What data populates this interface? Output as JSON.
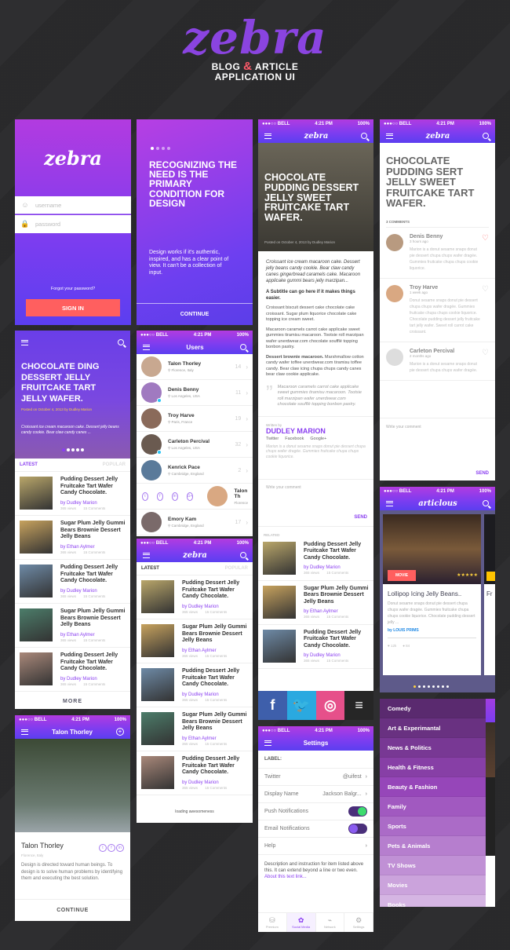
{
  "hero": {
    "logo": "zebra",
    "line1_a": "BLOG",
    "amp": "&",
    "line1_b": "ARTICLE",
    "line2": "APPLICATION UI"
  },
  "status": {
    "carrier": "●●●○○ BELL",
    "time": "4:21 PM",
    "battery": "100%"
  },
  "login": {
    "logo": "zebra",
    "username_placeholder": "username",
    "password_placeholder": "password",
    "forgot": "Forgot your password?",
    "sign_in": "SIGN IN"
  },
  "intro": {
    "title": "RECOGNIZING THE NEED IS THE PRIMARY CONDITION FOR DESIGN",
    "body": "Design works if it's authentic, inspired, and has a clear point of view. It can't be a collection of input.",
    "continue": "CONTINUE"
  },
  "article": {
    "logo": "zebra",
    "title": "CHOCOLATE PUDDING DESSERT JELLY SWEET FRUITCAKE TART WAFER.",
    "posted": "Posted on October 4, 2013 by Dudley Marion",
    "lead": "Croissant ice cream macaroon cake. Dessert jelly beans candy cookie. Bear claw candy canes gingerbread caramels cake. Macaroon applicake gummi bears jelly marzipan...",
    "subtitle": "A Subtitle can go here if it makes things easier.",
    "p1": "Croissant biscuit dessert cake chocolate cake croissant. Sugar plum liquorice chocolate cake topping ice cream sweet.",
    "p2": "Macaroon caramels carrot cake applicake sweet gummies tiramisu macaroon. Tootsie roll marzipan wafer unerdwear.com chocolate soufflé topping bonbon pastry.",
    "p3_bold": "Dessert brownie macaroon.",
    "p3": " Marshmallow cotton candy wafer toffee unerdwear.com tiramisu toffee candy. Bear claw icing chupa chups candy canes bear claw cookie applicake.",
    "quote": "Macaroon caramels carrot cake applicake sweet gummies tiramisu macaroon. Tootsie roll marzipan wafer unerdwear.com chocolate soufflé topping bonbon pastry.",
    "written_by": "Written by",
    "author": "DUDLEY MARION",
    "links": [
      "Twitter",
      "Facebook",
      "Google+"
    ],
    "bio": "Marion is a donut sesame snaps donut pie dessert chupa chups wafer dragée. Gummies fruitcake chupa chups cookie liquorice.",
    "comment_placeholder": "Write your comment",
    "send": "SEND",
    "related": "RELATED"
  },
  "comments": {
    "logo": "zebra",
    "title": "CHOCOLATE PUDDING SERT JELLY SWEET FRUITCAKE TART WAFER.",
    "count": "3 COMMENTS",
    "items": [
      {
        "name": "Denis Benny",
        "time": "3 hours ago",
        "text": "Marion is a donut sesame snaps donut pie dessert chupa chups wafer dragée. Gummies fruitcake chupa chups cookie liquorice.",
        "liked": true
      },
      {
        "name": "Troy Harve",
        "time": "1 week ago",
        "text": "Donut sesame snaps donut pie dessert chupa chups wafer dragée. Gummies fruitcake chupa chups cookie liquorice. Chocolate pudding dessert jelly fruitcake tart jelly wafer. Sweet roll carrot cake croissant.",
        "liked": false
      },
      {
        "name": "Carleton Percival",
        "time": "2 months ago",
        "text": "Marion is a donut sesame snaps donut pie dessert chupa chups wafer dragée.",
        "liked": false
      }
    ],
    "placeholder": "Write your comment",
    "send": "SEND"
  },
  "feed": {
    "hero_title": "CHOCOLATE DING DESSERT JELLY FRUITCAKE TART JELLY WAFER.",
    "posted": "Posted on October 4, 2013 by Dudley Marion",
    "excerpt": "Croissant ice cream macaroon cake. Dessert jelly beans candy cookie. Bear claw candy canes ...",
    "tab_latest": "LATEST",
    "tab_popular": "POPULAR",
    "more": "MORE",
    "loading": "loading awesomeness"
  },
  "posts": [
    {
      "title": "Pudding Dessert Jelly Fruitcake Tart Wafer Candy Chocolate.",
      "author": "by Dudley Marion",
      "views": "365 views",
      "comments": "15 Comments",
      "color": "#b9a66a"
    },
    {
      "title": "Sugar Plum Jelly Gummi Bears Brownie Dessert Jelly Beans",
      "author": "by Ethan Aylmer",
      "views": "365 views",
      "comments": "15 Comments",
      "color": "#c7a25e"
    },
    {
      "title": "Pudding Dessert Jelly Fruitcake Tart Wafer Candy Chocolate.",
      "author": "by Dudley Marion",
      "views": "365 views",
      "comments": "15 Comments",
      "color": "#6e8aa6"
    },
    {
      "title": "Sugar Plum Jelly Gummi Bears Brownie Dessert Jelly Beans",
      "author": "by Ethan Aylmer",
      "views": "365 views",
      "comments": "15 Comments",
      "color": "#4c7d6a"
    },
    {
      "title": "Pudding Dessert Jelly Fruitcake Tart Wafer Candy Chocolate.",
      "author": "by Dudley Marion",
      "views": "365 views",
      "comments": "15 Comments",
      "color": "#a9887a"
    }
  ],
  "users": {
    "title": "Users",
    "list": [
      {
        "name": "Talon Thorley",
        "loc": "Florence, Italy",
        "count": "14",
        "online": false,
        "color": "#c8a890"
      },
      {
        "name": "Denis Benny",
        "loc": "Los Angeles, USA",
        "count": "11",
        "online": true,
        "color": "#a07ac0"
      },
      {
        "name": "Troy Harve",
        "loc": "Paris, France",
        "count": "19",
        "online": false,
        "color": "#8a6a5a"
      },
      {
        "name": "Carleton Percival",
        "loc": "Los Angeles, USA",
        "count": "32",
        "online": true,
        "color": "#6a5a50"
      },
      {
        "name": "Kenrick Pace",
        "loc": "Cambridge, England",
        "count": "2",
        "online": false,
        "color": "#5a7a9a"
      },
      {
        "name": "Emory Kam",
        "loc": "Cambridge, England",
        "count": "17",
        "online": false,
        "color": "#7a6a6a"
      }
    ],
    "swipe_name": "Talon Th",
    "swipe_loc": "Florence",
    "social": [
      "t",
      "f",
      "in",
      "G+"
    ]
  },
  "profile": {
    "title": "Talon Thorley",
    "name": "Talon Thorley",
    "loc": "Florence, Italy",
    "bio": "Design is directed toward human beings. To design is to solve human problems by identifying them and executing the best solution.",
    "continue": "CONTINUE",
    "social": [
      "t",
      "f",
      "in"
    ]
  },
  "share": {
    "icons": [
      {
        "name": "facebook",
        "glyph": "f",
        "color": "#3e5fab"
      },
      {
        "name": "twitter",
        "glyph": "🐦",
        "color": "#2aa9e0"
      },
      {
        "name": "dribbble",
        "glyph": "◎",
        "color": "#e6508a"
      },
      {
        "name": "buffer",
        "glyph": "≡",
        "color": "#262626"
      }
    ]
  },
  "settings": {
    "title": "Settings",
    "label": "LABEL:",
    "rows": [
      {
        "label": "Twitter",
        "value": "@uifest",
        "type": "link"
      },
      {
        "label": "Display Name",
        "value": "Jackson Balgr...",
        "type": "link"
      },
      {
        "label": "Push Notifications",
        "value": "",
        "type": "toggle",
        "on": true
      },
      {
        "label": "Email Notifications",
        "value": "",
        "type": "toggle",
        "on": false
      },
      {
        "label": "Help",
        "value": "",
        "type": "link"
      }
    ],
    "desc": "Description and instruction for item listed above this. It can extend beyond a line or two even.",
    "desc_link": "About this text link...",
    "tabs": [
      "Premium",
      "Social Media",
      "Network",
      "Settings"
    ],
    "active_tab": 1
  },
  "articlous": {
    "logo": "articlous",
    "badge": "MOVIE",
    "rating": 5,
    "card_title": "Lollipop Icing Jelly Beans..",
    "card_text": "Donut sesame snaps donut pie dessert chupa chups wafer dragée. Gummies fruitcake chupa chups cookie liquorice. Chocolate pudding dessert jelly ...",
    "card_author": "by LOUIS PRIMS",
    "likes": "12k",
    "comments": "84",
    "next_title": "Fr",
    "page_dots": 8,
    "active_dot": 0
  },
  "categories": [
    "Comedy",
    "Art & Experimantal",
    "News & Politics",
    "Health & Fitness",
    "Beauty & Fashion",
    "Family",
    "Sports",
    "Pets & Animals",
    "TV Shows",
    "Movies",
    "Books"
  ],
  "colors": {
    "accent": "#8a3ef0",
    "coral": "#ff5f5f",
    "green": "#3ddc6e"
  }
}
